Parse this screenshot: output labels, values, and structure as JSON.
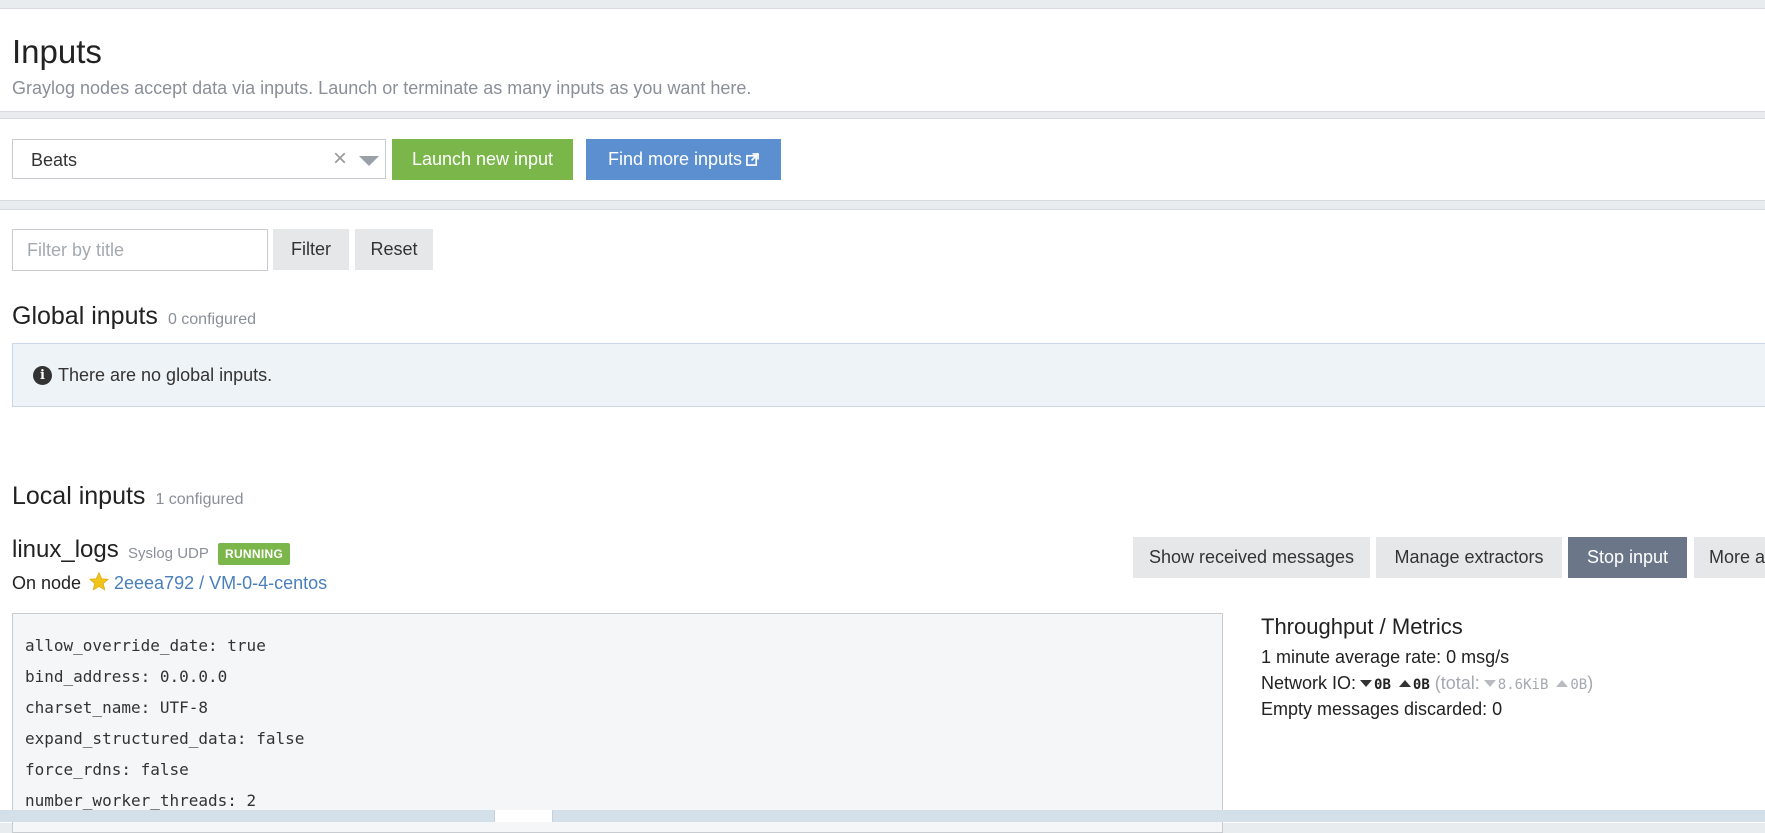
{
  "header": {
    "title": "Inputs",
    "subtitle": "Graylog nodes accept data via inputs. Launch or terminate as many inputs as you want here."
  },
  "launcher": {
    "selected_input_type": "Beats",
    "launch_label": "Launch new input",
    "find_more_label": "Find more inputs"
  },
  "filter": {
    "placeholder": "Filter by title",
    "filter_label": "Filter",
    "reset_label": "Reset"
  },
  "global_inputs": {
    "title": "Global inputs",
    "count": "0 configured",
    "empty_message": "There are no global inputs."
  },
  "local_inputs": {
    "title": "Local inputs",
    "count": "1 configured"
  },
  "input": {
    "name": "linux_logs",
    "type": "Syslog UDP",
    "status": "RUNNING",
    "on_node_label": "On node",
    "node": "2eeea792 / VM-0-4-centos",
    "actions": {
      "show_messages": "Show received messages",
      "manage_extractors": "Manage extractors",
      "stop": "Stop input",
      "more": "More actions"
    },
    "config": [
      "allow_override_date: true",
      "bind_address: 0.0.0.0",
      "charset_name: UTF-8",
      "expand_structured_data: false",
      "force_rdns: false",
      "number_worker_threads: 2"
    ],
    "metrics": {
      "title": "Throughput / Metrics",
      "rate": "1 minute average rate: 0 msg/s",
      "network_label": "Network IO:",
      "net_in": "0B",
      "net_out": "0B",
      "total_label": "(total:",
      "total_in": "8.6KiB",
      "total_out": "0B",
      "total_close": ")",
      "discarded": "Empty messages discarded: 0"
    }
  },
  "colors": {
    "success": "#7bb64a",
    "primary": "#5b8fd0",
    "stop": "#6b7788",
    "link": "#4a7fbd",
    "star": "#f0c419"
  }
}
